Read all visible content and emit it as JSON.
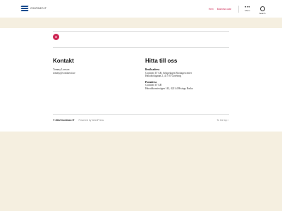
{
  "header": {
    "logo_text": "CONTINEO IT",
    "nav": [
      {
        "label": "Hem"
      },
      {
        "label": "Business case"
      }
    ],
    "menu_label": "Menu",
    "search_label": "Search"
  },
  "badge": {
    "icon": "mail-icon",
    "glyph": "✉"
  },
  "contact": {
    "title": "Kontakt",
    "name": "Tommy Larsson",
    "email": "tommy@contineoit.se"
  },
  "find_us": {
    "title": "Hitta till oss",
    "visit_heading": "Besöksadress",
    "visit_line1": "Contineo IT AB, Arkipelagen Brottagescenter",
    "visit_line2": "Hälsobölagatan 2, 417 05 Göteborg",
    "post_heading": "Postadress",
    "post_line1": "Contineo IT AB",
    "post_line2": "Härsdokonstrvägen 142, 422 44 Hisings Backa"
  },
  "footer": {
    "copyright": "© 2022 Contineo IT",
    "powered": "Powered by WordPress",
    "to_top": "To the top ↑"
  },
  "colors": {
    "accent": "#cd2653",
    "background": "#f5efe0",
    "brand": "#1a4d8f"
  }
}
